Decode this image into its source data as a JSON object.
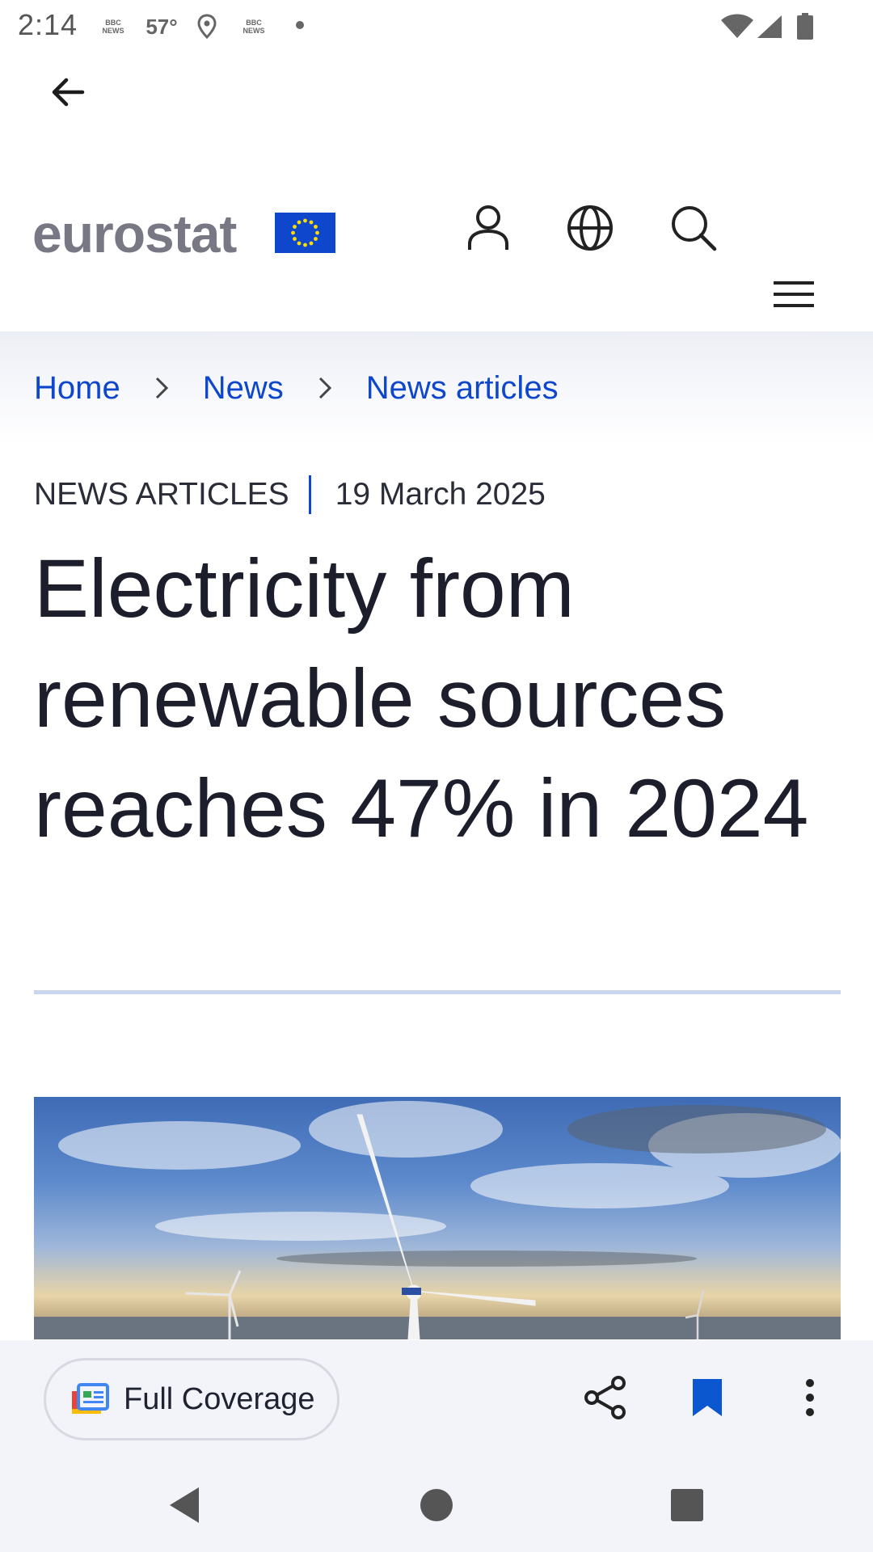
{
  "status_bar": {
    "time": "2:14",
    "temperature": "57°",
    "icons": [
      "bbc-news-icon",
      "temperature",
      "location-icon",
      "bbc-news-icon",
      "dot-icon",
      "wifi-icon",
      "signal-icon",
      "battery-icon"
    ],
    "bbc_label_top": "BBC",
    "bbc_label_bottom": "NEWS"
  },
  "app_bar": {
    "back_icon": "arrow-left-icon"
  },
  "site_header": {
    "logo_text": "eurostat",
    "icons": [
      "user-icon",
      "globe-icon",
      "search-icon",
      "menu-icon"
    ],
    "colors": {
      "eu_blue": "#0e47cb",
      "eu_star": "#ffdd00",
      "logo_grey": "#777884"
    }
  },
  "breadcrumb": {
    "items": [
      "Home",
      "News",
      "News articles"
    ],
    "link_color": "#0e47cb"
  },
  "article": {
    "category": "NEWS ARTICLES",
    "date": "19 March 2025",
    "title": "Electricity from renewable sources reaches 47% in 2024",
    "hero_image_alt": "wind turbines under cloudy sky"
  },
  "bottom_bar": {
    "full_coverage_label": "Full Coverage",
    "icons": [
      "full-coverage-icon",
      "share-icon",
      "bookmark-icon",
      "more-vert-icon"
    ],
    "bookmark_color": "#0b57d0"
  },
  "nav_bar": {
    "icons": [
      "back-triangle-icon",
      "home-circle-icon",
      "recents-square-icon"
    ]
  }
}
